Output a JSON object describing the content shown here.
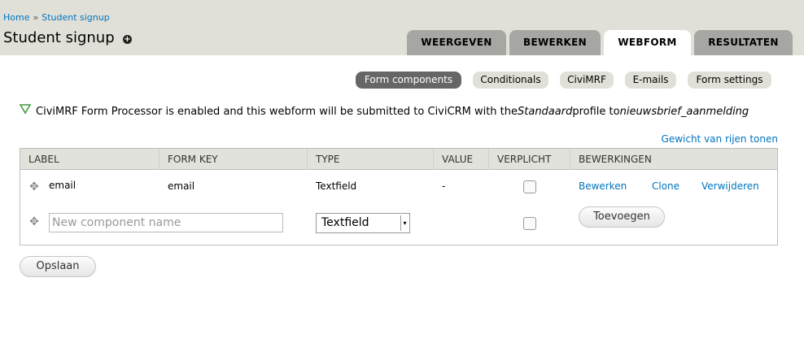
{
  "breadcrumb": {
    "home": "Home",
    "separator": "»",
    "current": "Student signup"
  },
  "page_title": "Student signup",
  "shortcut_icon": "+",
  "tabs": [
    {
      "label": "WEERGEVEN",
      "active": false
    },
    {
      "label": "BEWERKEN",
      "active": false
    },
    {
      "label": "WEBFORM",
      "active": true
    },
    {
      "label": "RESULTATEN",
      "active": false
    }
  ],
  "secondary_tabs": [
    {
      "label": "Form components",
      "active": true
    },
    {
      "label": "Conditionals",
      "active": false
    },
    {
      "label": "CiviMRF",
      "active": false
    },
    {
      "label": "E-mails",
      "active": false
    },
    {
      "label": "Form settings",
      "active": false
    }
  ],
  "status": {
    "text1": "CiviMRF Form Processor is enabled and this webform will be submitted to CiviCRM with the ",
    "profile": "Standaard",
    "text2": " profile to ",
    "target": "nieuwsbrief_aanmelding",
    "icon": "check-icon"
  },
  "weights_link": "Gewicht van rijen tonen",
  "table": {
    "headers": [
      "LABEL",
      "FORM KEY",
      "TYPE",
      "VALUE",
      "VERPLICHT",
      "BEWERKINGEN"
    ],
    "rows": [
      {
        "label": "email",
        "form_key": "email",
        "type": "Textfield",
        "value": "-",
        "required": false,
        "ops": [
          "Bewerken",
          "Clone",
          "Verwijderen"
        ]
      }
    ],
    "new_row": {
      "placeholder": "New component name",
      "type_selected": "Textfield",
      "required": false,
      "add_button": "Toevoegen"
    }
  },
  "save_button": "Opslaan",
  "colors": {
    "link": "#0074bd",
    "header_bg": "#e0e0d8",
    "tab_bg": "#a6a7a2",
    "active_sec_tab": "#666666"
  }
}
